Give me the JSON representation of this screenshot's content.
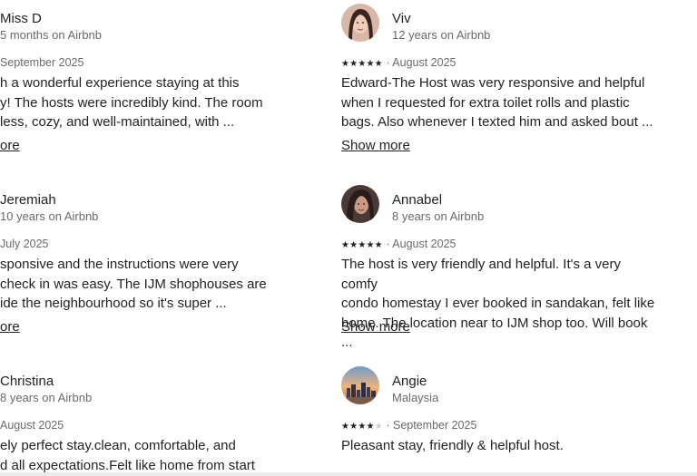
{
  "reviews": [
    {
      "name": "Miss D",
      "sub": "5 months on Airbnb",
      "date": "September 2025",
      "text": "...ch a wonderful experience staying at this ...ay! The hosts were incredibly kind. The room ...cless, cozy, and well-maintained, with ...",
      "line1": "h a wonderful experience staying at this",
      "line2": "y! The hosts were incredibly kind. The room",
      "line3": "less, cozy, and well-maintained, with ...",
      "more": "ore"
    },
    {
      "name": "Viv",
      "sub": "12 years on Airbnb",
      "stars": 5,
      "date": "August 2025",
      "line1": "Edward-The Host was very responsive and helpful",
      "line2": "when I requested for extra toilet rolls and plastic",
      "line3": "bags. Also whenever I texted him and asked bout ...",
      "more": "Show more"
    },
    {
      "name": "Jeremiah",
      "sub": "10 years on Airbnb",
      "date": "July 2025",
      "line1": "sponsive and the instructions were very",
      "line2": "check in was easy. The IJM shophouses are",
      "line3": "ide the neighbourhood so it's super ...",
      "more": "ore"
    },
    {
      "name": "Annabel",
      "sub": "8 years on Airbnb",
      "stars": 5,
      "date": "August 2025",
      "line1": "The host is very friendly and helpful. It's a very comfy",
      "line2": "condo homestay I ever booked in sandakan, felt like",
      "line3": "home. The location near to IJM shop too. Will book ...",
      "more": "Show more"
    },
    {
      "name": "Christina",
      "sub": "8 years on Airbnb",
      "date": "August 2025",
      "line1": "ely perfect stay.clean, comfortable, and",
      "line2": "d all expectations.Felt like home from start",
      "line3": ""
    },
    {
      "name": "Angie",
      "sub": "Malaysia",
      "stars": 4,
      "date": "September 2025",
      "line1": "Pleasant stay, friendly & helpful host.",
      "line2": "",
      "line3": ""
    }
  ],
  "separator": "·",
  "star_glyph": "★",
  "colors": {
    "text": "#222222",
    "muted": "#6a6a6a",
    "star_off": "#cfcfcf"
  }
}
